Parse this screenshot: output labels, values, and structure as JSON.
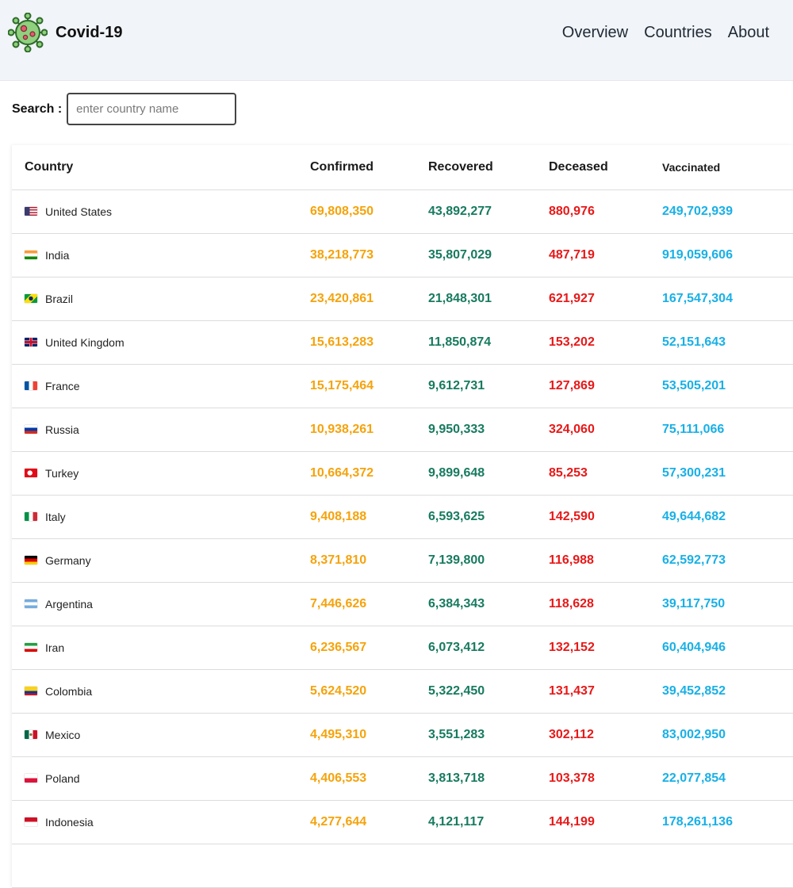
{
  "app": {
    "title": "Covid-19",
    "logo_icon": "virus-icon"
  },
  "nav": {
    "links": [
      "Overview",
      "Countries",
      "About"
    ]
  },
  "search": {
    "label": "Search :",
    "placeholder": "enter country name",
    "value": ""
  },
  "colors": {
    "confirmed": "#f5a30c",
    "recovered": "#177a5f",
    "deceased": "#e81818",
    "vaccinated": "#18b0e6",
    "navbar_bg": "#f1f4f8"
  },
  "table": {
    "headers": {
      "country": "Country",
      "confirmed": "Confirmed",
      "recovered": "Recovered",
      "deceased": "Deceased",
      "vaccinated": "Vaccinated"
    },
    "rows": [
      {
        "flag": "us-flag-icon",
        "country": "United States",
        "confirmed": "69,808,350",
        "recovered": "43,892,277",
        "deceased": "880,976",
        "vaccinated": "249,702,939"
      },
      {
        "flag": "in-flag-icon",
        "country": "India",
        "confirmed": "38,218,773",
        "recovered": "35,807,029",
        "deceased": "487,719",
        "vaccinated": "919,059,606"
      },
      {
        "flag": "br-flag-icon",
        "country": "Brazil",
        "confirmed": "23,420,861",
        "recovered": "21,848,301",
        "deceased": "621,927",
        "vaccinated": "167,547,304"
      },
      {
        "flag": "gb-flag-icon",
        "country": "United Kingdom",
        "confirmed": "15,613,283",
        "recovered": "11,850,874",
        "deceased": "153,202",
        "vaccinated": "52,151,643"
      },
      {
        "flag": "fr-flag-icon",
        "country": "France",
        "confirmed": "15,175,464",
        "recovered": "9,612,731",
        "deceased": "127,869",
        "vaccinated": "53,505,201"
      },
      {
        "flag": "ru-flag-icon",
        "country": "Russia",
        "confirmed": "10,938,261",
        "recovered": "9,950,333",
        "deceased": "324,060",
        "vaccinated": "75,111,066"
      },
      {
        "flag": "tr-flag-icon",
        "country": "Turkey",
        "confirmed": "10,664,372",
        "recovered": "9,899,648",
        "deceased": "85,253",
        "vaccinated": "57,300,231"
      },
      {
        "flag": "it-flag-icon",
        "country": "Italy",
        "confirmed": "9,408,188",
        "recovered": "6,593,625",
        "deceased": "142,590",
        "vaccinated": "49,644,682"
      },
      {
        "flag": "de-flag-icon",
        "country": "Germany",
        "confirmed": "8,371,810",
        "recovered": "7,139,800",
        "deceased": "116,988",
        "vaccinated": "62,592,773"
      },
      {
        "flag": "ar-flag-icon",
        "country": "Argentina",
        "confirmed": "7,446,626",
        "recovered": "6,384,343",
        "deceased": "118,628",
        "vaccinated": "39,117,750"
      },
      {
        "flag": "ir-flag-icon",
        "country": "Iran",
        "confirmed": "6,236,567",
        "recovered": "6,073,412",
        "deceased": "132,152",
        "vaccinated": "60,404,946"
      },
      {
        "flag": "co-flag-icon",
        "country": "Colombia",
        "confirmed": "5,624,520",
        "recovered": "5,322,450",
        "deceased": "131,437",
        "vaccinated": "39,452,852"
      },
      {
        "flag": "mx-flag-icon",
        "country": "Mexico",
        "confirmed": "4,495,310",
        "recovered": "3,551,283",
        "deceased": "302,112",
        "vaccinated": "83,002,950"
      },
      {
        "flag": "pl-flag-icon",
        "country": "Poland",
        "confirmed": "4,406,553",
        "recovered": "3,813,718",
        "deceased": "103,378",
        "vaccinated": "22,077,854"
      },
      {
        "flag": "id-flag-icon",
        "country": "Indonesia",
        "confirmed": "4,277,644",
        "recovered": "4,121,117",
        "deceased": "144,199",
        "vaccinated": "178,261,136"
      }
    ]
  }
}
